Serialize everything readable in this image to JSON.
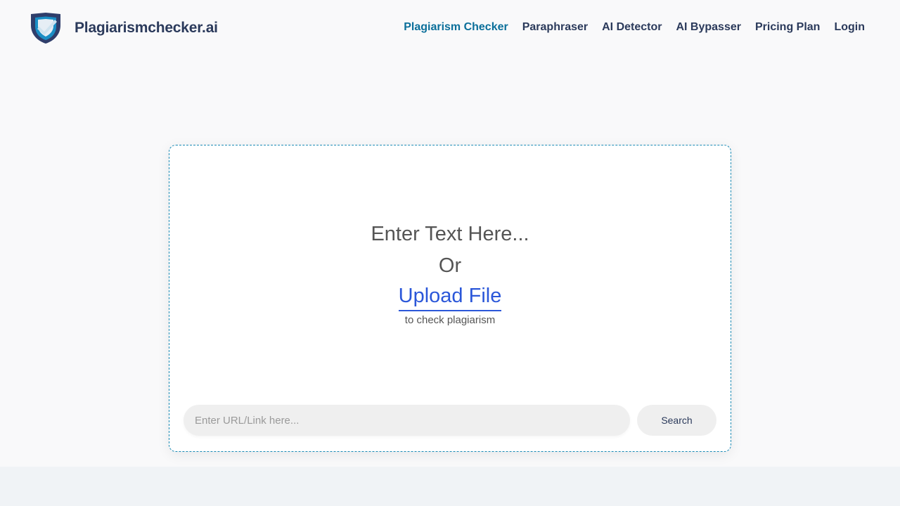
{
  "brand": {
    "name": "Plagiarismchecker.ai",
    "logo_icon": "shield-check-icon",
    "colors": {
      "shield_dark": "#2f3e6b",
      "shield_blue": "#1a8ec5",
      "check": "#cfe3ef"
    }
  },
  "nav": {
    "items": [
      {
        "label": "Plagiarism Checker",
        "active": true
      },
      {
        "label": "Paraphraser",
        "active": false
      },
      {
        "label": "AI Detector",
        "active": false
      },
      {
        "label": "AI Bypasser",
        "active": false
      },
      {
        "label": "Pricing Plan",
        "active": false
      },
      {
        "label": "Login",
        "active": false
      }
    ]
  },
  "editor": {
    "prompt": "Enter Text Here...",
    "or_text": "Or",
    "upload_label": "Upload File",
    "subtext": "to check plagiarism"
  },
  "url_search": {
    "placeholder": "Enter URL/Link here...",
    "value": "",
    "button_label": "Search"
  },
  "colors": {
    "nav_text": "#2b3a5b",
    "nav_active": "#0b6f9a",
    "link": "#2b57d9",
    "card_border": "#1a8ab5"
  }
}
